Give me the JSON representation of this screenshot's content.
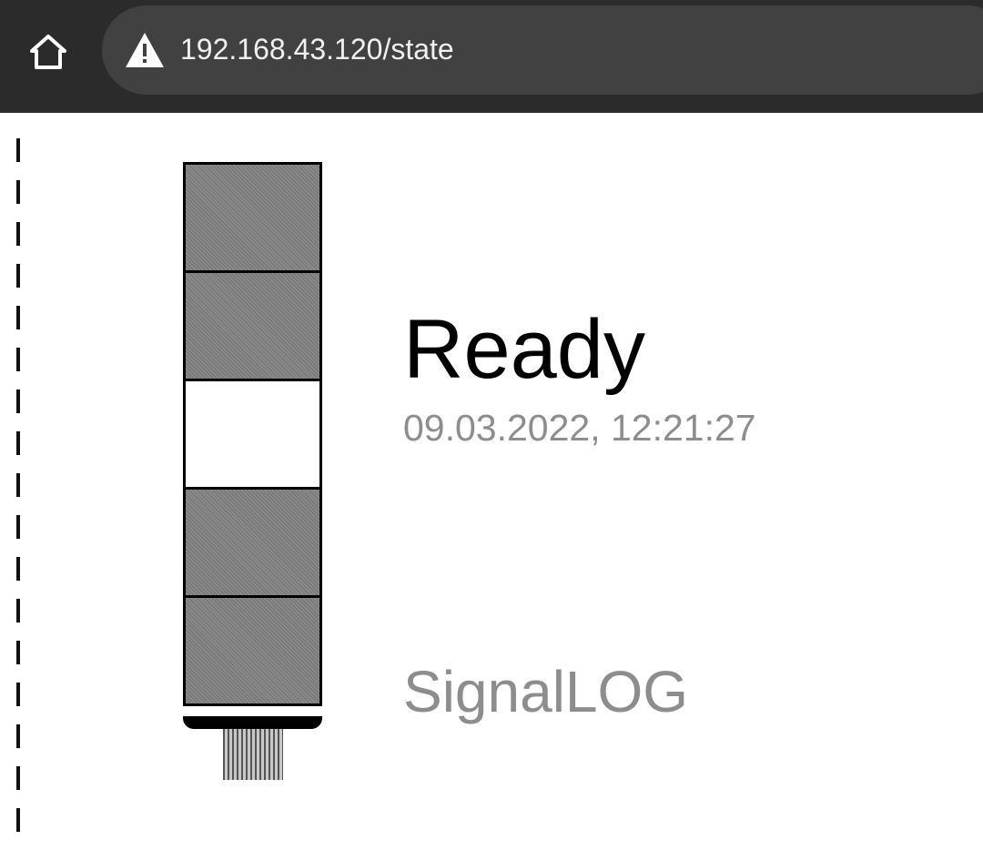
{
  "browser": {
    "url": "192.168.43.120/state",
    "home_icon": "home-icon",
    "security_icon": "warning-triangle-icon"
  },
  "signal_tower": {
    "segments": [
      {
        "state": "off",
        "color": "#8a8a8a"
      },
      {
        "state": "off",
        "color": "#8a8a8a"
      },
      {
        "state": "on",
        "color": "#ffffff"
      },
      {
        "state": "off",
        "color": "#8a8a8a"
      },
      {
        "state": "off",
        "color": "#8a8a8a"
      }
    ]
  },
  "status": {
    "label": "Ready",
    "timestamp": "09.03.2022, 12:21:27",
    "device": "SignalLOG"
  }
}
